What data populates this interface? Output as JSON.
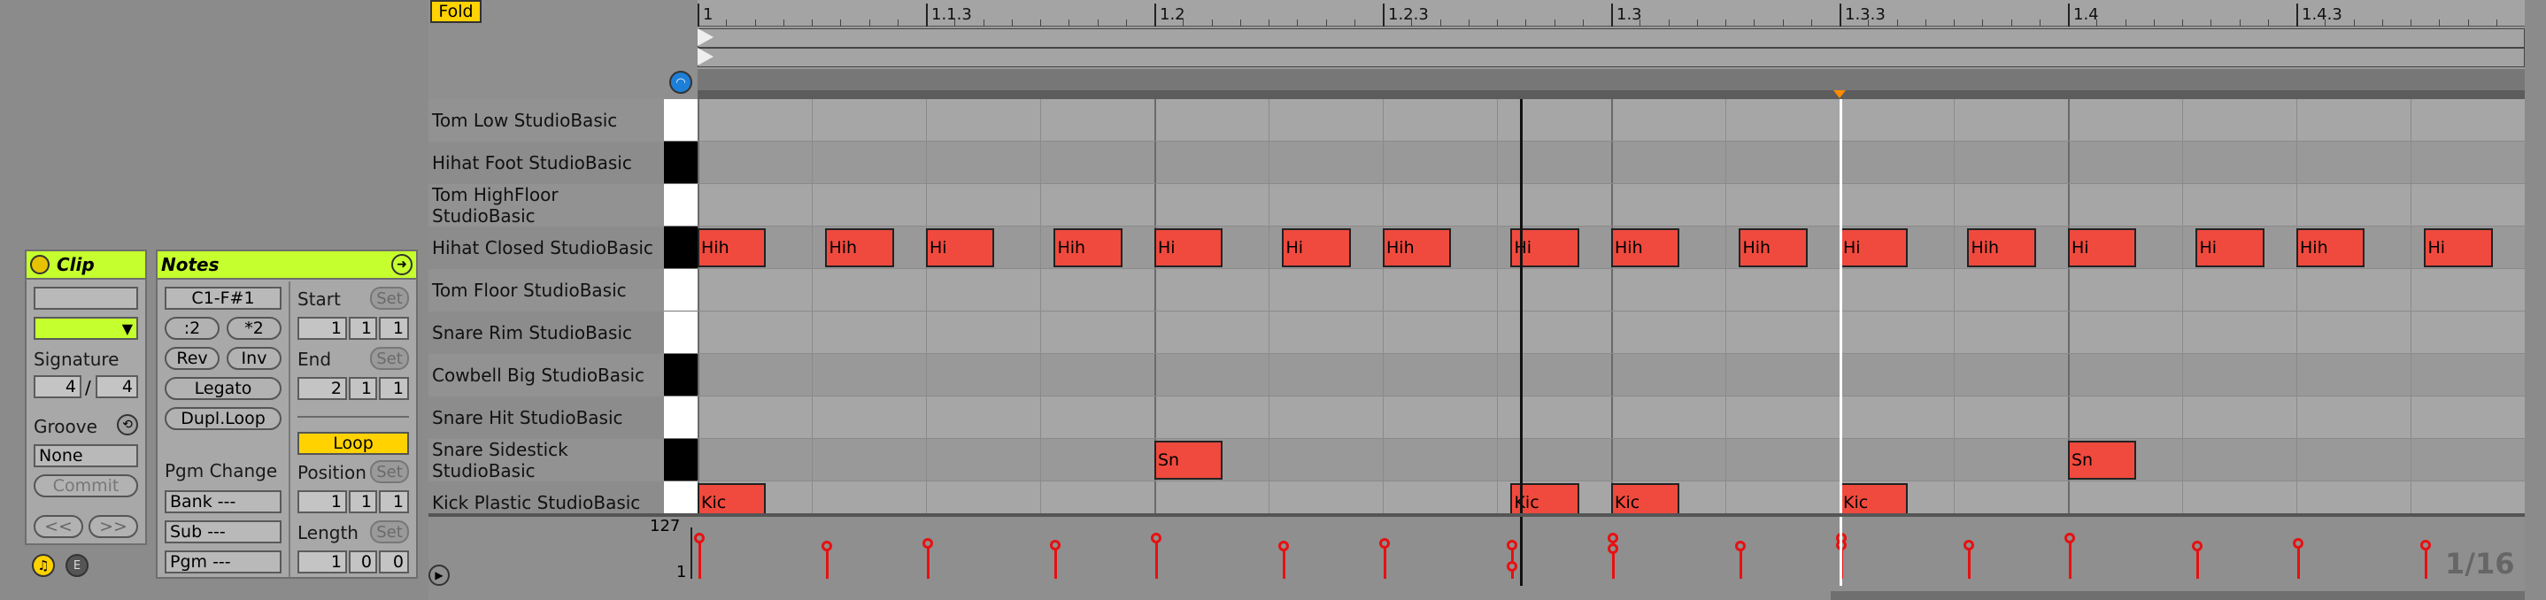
{
  "fold_label": "Fold",
  "clip": {
    "title": "Clip",
    "signature_label": "Signature",
    "sig_num": "4",
    "sig_sep": "/",
    "sig_den": "4",
    "groove_label": "Groove",
    "groove_value": "None",
    "commit_label": "Commit",
    "prev_label": "<<",
    "next_label": ">>"
  },
  "notes": {
    "title": "Notes",
    "range": "C1-F#1",
    "half_label": ":2",
    "double_label": "*2",
    "rev_label": "Rev",
    "inv_label": "Inv",
    "legato_label": "Legato",
    "dupl_label": "Dupl.Loop",
    "start_label": "Start",
    "start": [
      "1",
      "1",
      "1"
    ],
    "end_label": "End",
    "end": [
      "2",
      "1",
      "1"
    ],
    "set_label": "Set",
    "loop_label": "Loop",
    "position_label": "Position",
    "position": [
      "1",
      "1",
      "1"
    ],
    "length_label": "Length",
    "length": [
      "1",
      "0",
      "0"
    ],
    "pgm_change_label": "Pgm Change",
    "bank": "Bank ---",
    "sub": "Sub ---",
    "pgm": "Pgm ---"
  },
  "ruler": {
    "marks": [
      "1",
      "1.1.3",
      "1.2",
      "1.2.3",
      "1.3",
      "1.3.3",
      "1.4",
      "1.4.3"
    ]
  },
  "lanes": [
    {
      "name": "Tom Low StudioBasic",
      "key": "white"
    },
    {
      "name": "Hihat Foot StudioBasic",
      "key": "black"
    },
    {
      "name": "Tom HighFloor StudioBasic",
      "key": "white"
    },
    {
      "name": "Hihat Closed StudioBasic",
      "key": "black"
    },
    {
      "name": "Tom Floor StudioBasic",
      "key": "white"
    },
    {
      "name": "Snare Rim StudioBasic",
      "key": "white"
    },
    {
      "name": "Cowbell Big StudioBasic",
      "key": "black"
    },
    {
      "name": "Snare Hit StudioBasic",
      "key": "white"
    },
    {
      "name": "Snare Sidestick StudioBasic",
      "key": "black"
    },
    {
      "name": "Kick Plastic StudioBasic",
      "key": "white"
    }
  ],
  "notes_grid": [
    {
      "lane": 3,
      "label": "Hih",
      "start": 0.0,
      "len": 0.075
    },
    {
      "lane": 3,
      "label": "Hih",
      "start": 0.14,
      "len": 0.075
    },
    {
      "lane": 3,
      "label": "Hi",
      "start": 0.25,
      "len": 0.075
    },
    {
      "lane": 3,
      "label": "Hih",
      "start": 0.39,
      "len": 0.075
    },
    {
      "lane": 3,
      "label": "Hi",
      "start": 0.5,
      "len": 0.075
    },
    {
      "lane": 3,
      "label": "Hi",
      "start": 0.64,
      "len": 0.075
    },
    {
      "lane": 3,
      "label": "Hih",
      "start": 0.75,
      "len": 0.075
    },
    {
      "lane": 3,
      "label": "Hi",
      "start": 0.89,
      "len": 0.075
    },
    {
      "lane": 3,
      "label": "Hih",
      "start": 1.0,
      "len": 0.075
    },
    {
      "lane": 3,
      "label": "Hih",
      "start": 1.14,
      "len": 0.075
    },
    {
      "lane": 3,
      "label": "Hi",
      "start": 1.25,
      "len": 0.075
    },
    {
      "lane": 3,
      "label": "Hih",
      "start": 1.39,
      "len": 0.075
    },
    {
      "lane": 3,
      "label": "Hi",
      "start": 1.5,
      "len": 0.075
    },
    {
      "lane": 3,
      "label": "Hi",
      "start": 1.64,
      "len": 0.075
    },
    {
      "lane": 3,
      "label": "Hih",
      "start": 1.75,
      "len": 0.075
    },
    {
      "lane": 3,
      "label": "Hi",
      "start": 1.89,
      "len": 0.075
    },
    {
      "lane": 8,
      "label": "Sn",
      "start": 0.5,
      "len": 0.075
    },
    {
      "lane": 8,
      "label": "Sn",
      "start": 1.5,
      "len": 0.075
    },
    {
      "lane": 9,
      "label": "Kic",
      "start": 0.0,
      "len": 0.075
    },
    {
      "lane": 9,
      "label": "Kic",
      "start": 0.89,
      "len": 0.075
    },
    {
      "lane": 9,
      "label": "Kic",
      "start": 1.0,
      "len": 0.075
    },
    {
      "lane": 9,
      "label": "Kic",
      "start": 1.25,
      "len": 0.075
    }
  ],
  "velocity": {
    "max_label": "127",
    "min_label": "1",
    "values": [
      {
        "pos": 0.0,
        "v": 100
      },
      {
        "pos": 0.14,
        "v": 80
      },
      {
        "pos": 0.25,
        "v": 88
      },
      {
        "pos": 0.39,
        "v": 84
      },
      {
        "pos": 0.5,
        "v": 100
      },
      {
        "pos": 0.64,
        "v": 80
      },
      {
        "pos": 0.75,
        "v": 88
      },
      {
        "pos": 0.89,
        "v": 84
      },
      {
        "pos": 0.89,
        "v": 30
      },
      {
        "pos": 1.0,
        "v": 100
      },
      {
        "pos": 1.0,
        "v": 75
      },
      {
        "pos": 1.14,
        "v": 80
      },
      {
        "pos": 1.25,
        "v": 100
      },
      {
        "pos": 1.25,
        "v": 84
      },
      {
        "pos": 1.39,
        "v": 84
      },
      {
        "pos": 1.5,
        "v": 100
      },
      {
        "pos": 1.64,
        "v": 80
      },
      {
        "pos": 1.75,
        "v": 88
      },
      {
        "pos": 1.89,
        "v": 84
      }
    ]
  },
  "grid_label": "1/16",
  "playhead_pos": 0.9,
  "loop_end_pos": 1.25,
  "colors": {
    "accent": "#c6ff2e",
    "note": "#f04a3e",
    "velocity": "#e81010",
    "loop_button": "#ffd200"
  }
}
